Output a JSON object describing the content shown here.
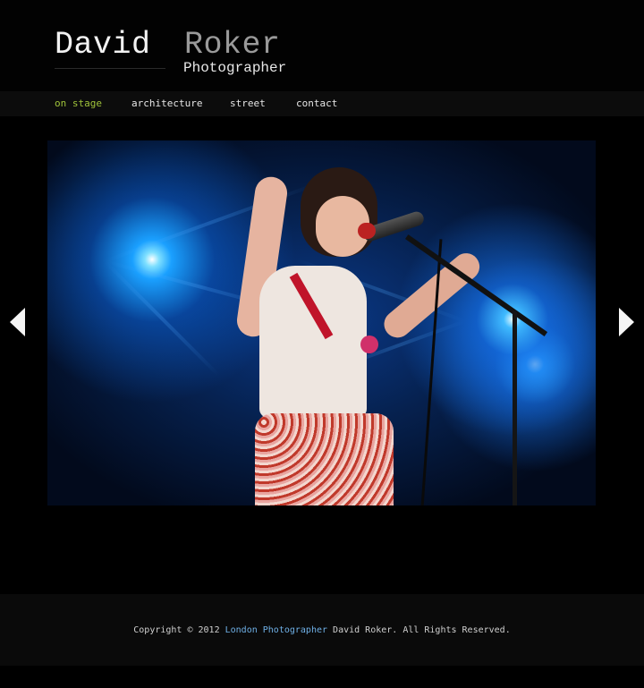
{
  "header": {
    "logo_first": "David",
    "logo_last": "Roker",
    "tagline": "Photographer"
  },
  "nav": {
    "items": [
      {
        "label": "on stage",
        "active": true
      },
      {
        "label": "architecture",
        "active": false
      },
      {
        "label": "street",
        "active": false
      },
      {
        "label": "contact",
        "active": false
      }
    ]
  },
  "gallery": {
    "photo_alt": "Singer performing on stage with microphone under blue stage lights",
    "prev_icon": "arrow-left-icon",
    "next_icon": "arrow-right-icon"
  },
  "footer": {
    "copyright_prefix": "Copyright © 2012",
    "copyright_link": "London Photographer",
    "copyright_suffix": "David Roker. All Rights Reserved."
  },
  "colors": {
    "background": "#000000",
    "nav_active": "#9fc23a",
    "footer_link": "#6fb0e6",
    "logo_last": "#9a9a9a"
  }
}
